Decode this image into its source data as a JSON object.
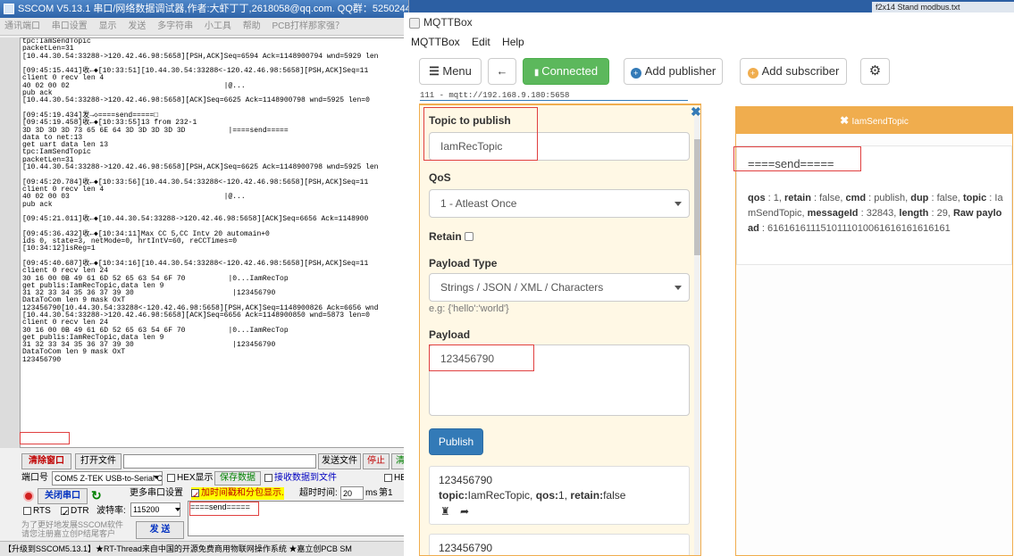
{
  "sscom": {
    "title": "SSCOM V5.13.1 串口/网络数据调试器,作者:大虾丁丁,2618058@qq.com. QQ群：52502449(最新版本)",
    "menu": [
      "通讯端口",
      "串口设置",
      "显示",
      "发送",
      "多字符串",
      "小工具",
      "帮助",
      "PCB打样那家强？"
    ],
    "log_lines": [
      "tpc:IamSendTopic",
      "packetLen=31",
      "[10.44.30.54:33288->120.42.46.98:5658][PSH,ACK]Seq=6594 Ack=1148900794 wnd=5929 len",
      "",
      "[09:45:15.441]收←◆[10:33:51][10.44.30.54:33288<-120.42.46.98:5658][PSH,ACK]Seq=11",
      "client 0 recv len 4",
      "40 02 00 02                                    |@...",
      "pub ack",
      "[10.44.30.54:33288->120.42.46.98:5658][ACK]Seq=6625 Ack=1148900798 wnd=5925 len=0",
      "",
      "[09:45:19.434]发→◇====send=====□",
      "[09:45:19.458]收←◆[10:33:55]13 from 232-1",
      "3D 3D 3D 3D 73 65 6E 64 3D 3D 3D 3D 3D          |====send=====",
      "data to net:13",
      "get uart data len 13",
      "tpc:IamSendTopic",
      "packetLen=31",
      "[10.44.30.54:33288->120.42.46.98:5658][PSH,ACK]Seq=6625 Ack=1148900798 wnd=5925 len",
      "",
      "[09:45:20.784]收←◆[10:33:56][10.44.30.54:33288<-120.42.46.98:5658][PSH,ACK]Seq=11",
      "client 0 recv len 4",
      "40 02 00 03                                    |@...",
      "pub ack",
      "",
      "[09:45:21.011]收←◆[10.44.30.54:33288->120.42.46.98:5658][ACK]Seq=6656 Ack=1148900",
      "",
      "[09:45:36.432]收←◆[10:34:11]Max CC 5,CC Intv 20 automain+0",
      "ids 0, state=3, netMode=0, hrtIntV=60, reCCTimes=0",
      "[10:34:12]isReg=1",
      "",
      "[09:45:40.687]收←◆[10:34:16][10.44.30.54:33288<-120.42.46.98:5658][PSH,ACK]Seq=11",
      "client 0 recv len 24",
      "30 16 00 0B 49 61 6D 52 65 63 54 6F 70          |0...IamRecTop",
      "get publis:IamRecTopic,data len 9",
      "31 32 33 34 35 36 37 39 30                       |123456790",
      "DataToCom len 9 mask OxT",
      "123456790[10.44.30.54:33288<-120.42.46.98:5658][PSH,ACK]Seq=1148900826 Ack=6656 wnd",
      "[10.44.30.54:33288->120.42.46.98:5658][ACK]Seq=6656 Ack=1148900850 wnd=5873 len=0",
      "client 0 recv len 24",
      "30 16 00 0B 49 61 6D 52 65 63 54 6F 70          |0...IamRecTop",
      "get publis:IamRecTopic,data len 9",
      "31 32 33 34 35 36 37 39 30                       |123456790",
      "DataToCom len 9 mask OxT",
      "123456790"
    ],
    "clear_btn": "清除窗口",
    "open_file_btn": "打开文件",
    "send_file_btn": "发送文件",
    "stop_btn": "停止",
    "port_label": "端口号",
    "port_value": "COM5 Z-TEK USB-to-Serial C",
    "hex_display": "HEX显示",
    "save_data": "保存数据",
    "recv_to_file": "接收数据到文件",
    "hex_send": "HE",
    "close_port_btn": "关闭串口",
    "more_settings": "更多串口设置",
    "add_timestamp": "加时间戳和分包显示.",
    "timeout_label": "超时时间:",
    "timeout_value": "20",
    "ms_label": "ms",
    "page_label": "第1",
    "rts": "RTS",
    "dtr": "DTR",
    "baud_label": "波特率:",
    "baud_value": "115200",
    "send_input": "====send=====",
    "promo": "为了更好地发展SSCOM软件\n请您注册嘉立创P结尾客户",
    "send_btn": "发 送",
    "status": "【升级到SSCOM5.13.1】★RT-Thread来自中国的开源免费商用物联网操作系统 ★嘉立创PCB SM"
  },
  "desktop": {
    "taskbar_item": "f2x14 Stand   modbus.txt"
  },
  "mqtt": {
    "title": "MQTTBox",
    "menu": [
      "MQTTBox",
      "Edit",
      "Help"
    ],
    "toolbar": {
      "menu_btn": "Menu",
      "connected_btn": "Connected",
      "add_publisher": "Add publisher",
      "add_subscriber": "Add subscriber"
    },
    "conn_info": "111 - mqtt://192.168.9.180:5658",
    "publisher": {
      "topic_label": "Topic to publish",
      "topic_value": "IamRecTopic",
      "qos_label": "QoS",
      "qos_value": "1 - Atleast Once",
      "retain_label": "Retain",
      "payload_type_label": "Payload Type",
      "payload_type_value": "Strings / JSON / XML / Characters",
      "example": "e.g: {'hello':'world'}",
      "payload_label": "Payload",
      "payload_value": "123456790",
      "publish_btn": "Publish"
    },
    "history": [
      {
        "payload": "123456790",
        "topic_key": "topic:",
        "topic_val": "IamRecTopic",
        "qos_key": "qos:",
        "qos_val": "1",
        "retain_key": "retain:",
        "retain_val": "false"
      },
      {
        "payload": "123456790"
      }
    ],
    "subscriber": {
      "topic": "IamSendTopic",
      "message": "====send=====",
      "qos_key": "qos",
      "qos_val": " : 1, ",
      "retain_key": "retain",
      "retain_val": " : false, ",
      "cmd_key": "cmd",
      "cmd_val": " : publish, ",
      "dup_key": "dup",
      "dup_val": " : false, ",
      "topic_key": "topic",
      "topic_val": " : IamSendTopic, ",
      "msgid_key": "messageId",
      "msgid_val": " : 32843, ",
      "length_key": "length",
      "length_val": " : 29, ",
      "raw_key": "Raw payload",
      "raw_val": " : 6161616111510111010061616161616161"
    }
  }
}
